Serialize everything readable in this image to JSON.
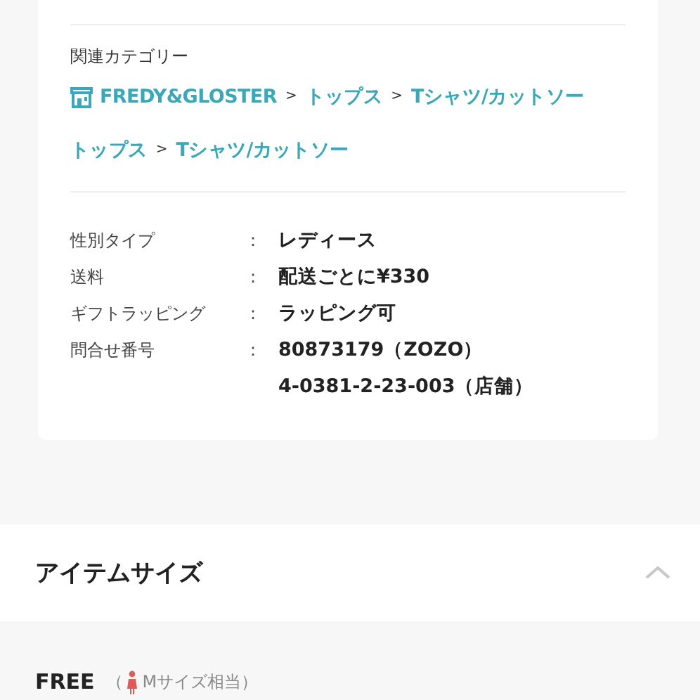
{
  "related_categories": {
    "label": "関連カテゴリー",
    "paths": [
      {
        "separator": ">",
        "crumbs": [
          {
            "kind": "brand",
            "text": "FREDY&GLOSTER"
          },
          {
            "kind": "category",
            "text": "トップス"
          },
          {
            "kind": "category",
            "text": "Tシャツ/カットソー"
          }
        ]
      },
      {
        "separator": ">",
        "crumbs": [
          {
            "kind": "category",
            "text": "トップス"
          },
          {
            "kind": "category",
            "text": "Tシャツ/カットソー"
          }
        ]
      }
    ]
  },
  "specs": [
    {
      "label": "性別タイプ",
      "separator": ":",
      "values": [
        "レディース"
      ]
    },
    {
      "label": "送料",
      "separator": ":",
      "values": [
        "配送ごとに¥330"
      ]
    },
    {
      "label": "ギフトラッピング",
      "separator": ":",
      "values": [
        "ラッピング可"
      ]
    },
    {
      "label": "問合せ番号",
      "separator": ":",
      "values": [
        "80873179（ZOZO）",
        "4-0381-2-23-003（店舗）"
      ]
    }
  ],
  "item_size": {
    "title": "アイテムサイズ",
    "expanded": true,
    "sizes": [
      {
        "name": "FREE",
        "open_paren": "（",
        "equivalent": "Mサイズ相当）"
      }
    ]
  }
}
